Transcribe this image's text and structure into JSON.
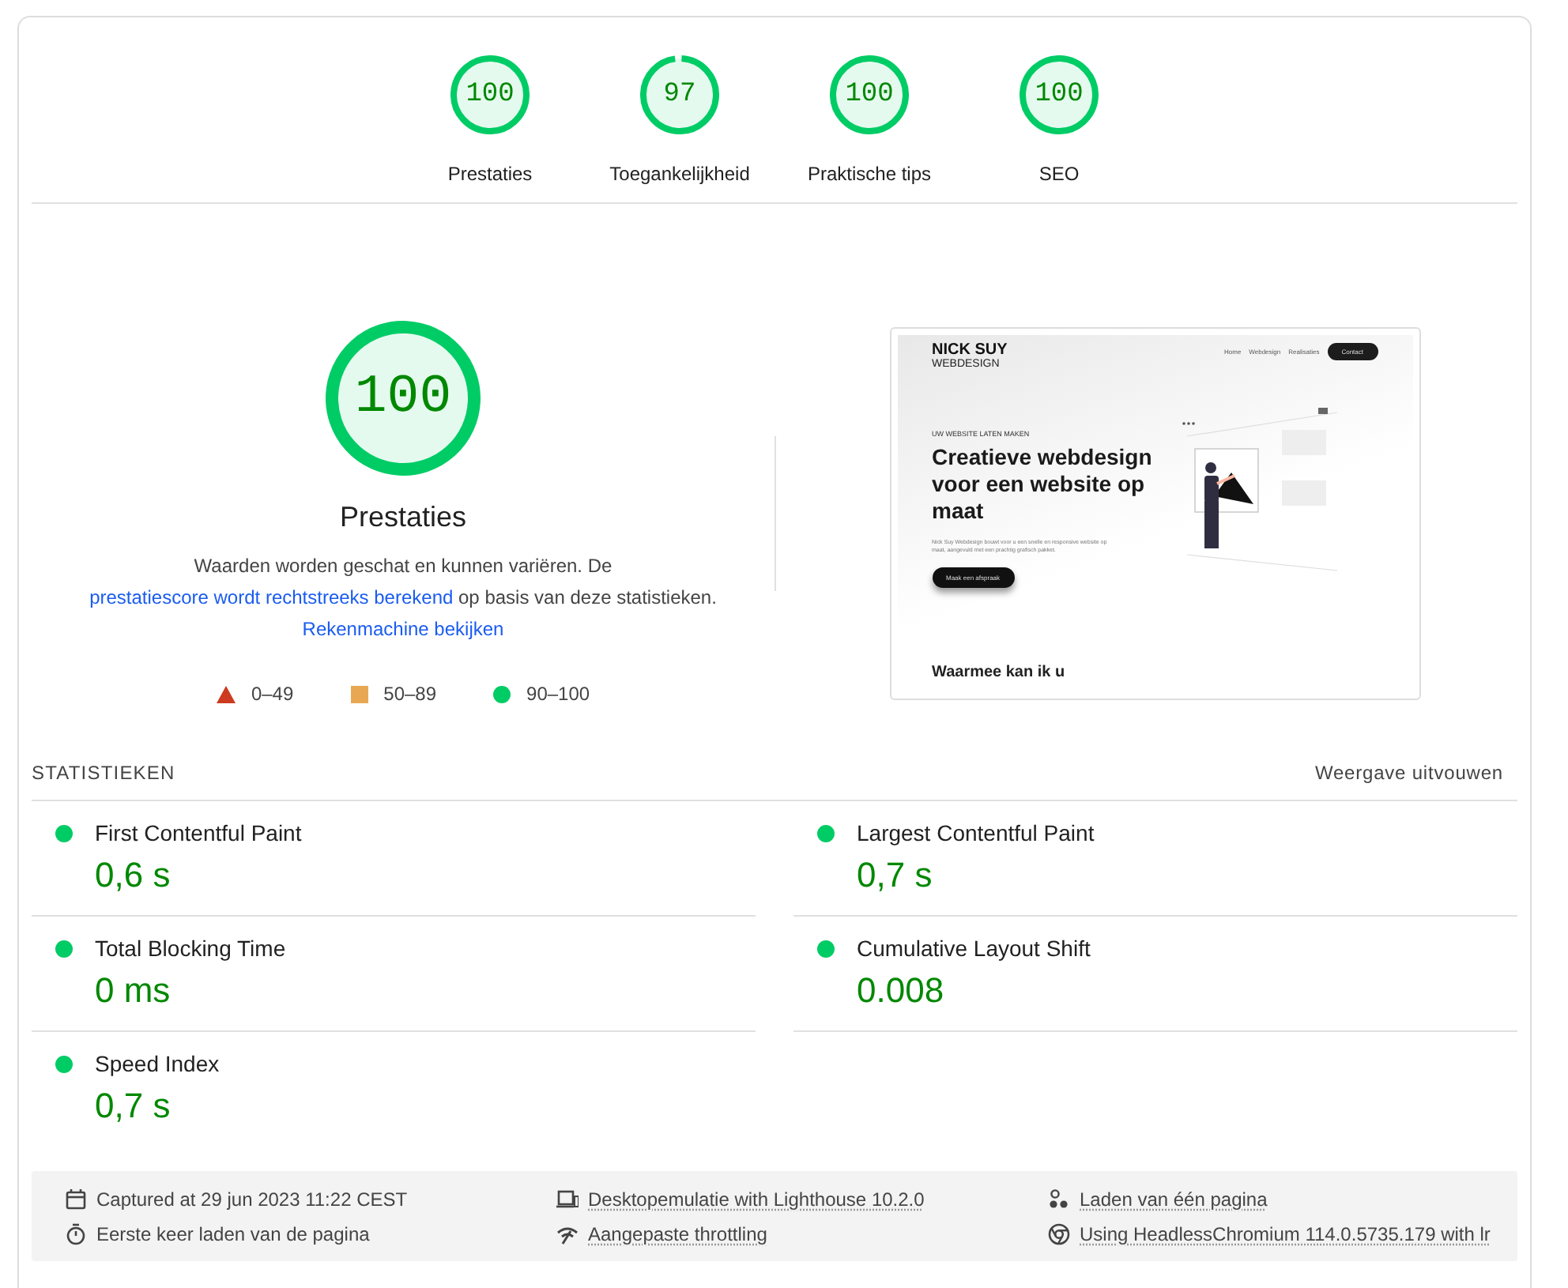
{
  "categories": [
    {
      "label": "Prestaties",
      "score": "100",
      "level": 1.0
    },
    {
      "label": "Toegankelijkheid",
      "score": "97",
      "level": 0.97
    },
    {
      "label": "Praktische tips",
      "score": "100",
      "level": 1.0
    },
    {
      "label": "SEO",
      "score": "100",
      "level": 1.0
    }
  ],
  "summary": {
    "score": "100",
    "level": 1.0,
    "title": "Prestaties",
    "description": [
      {
        "text": "Waarden worden geschat en kunnen variëren. De ",
        "link": false
      },
      {
        "text": "prestatiescore wordt rechtstreeks berekend",
        "link": true
      },
      {
        "text": " op basis van deze statistieken. ",
        "link": false
      },
      {
        "text": "Rekenmachine bekijken",
        "link": true
      }
    ],
    "legend": [
      {
        "kind": "fail",
        "label": "0–49"
      },
      {
        "kind": "average",
        "label": "50–89"
      },
      {
        "kind": "pass",
        "label": "90–100"
      }
    ]
  },
  "screenshot": {
    "logo": "NICK SUY",
    "logo_sub": "WEBDESIGN",
    "nav": [
      "Home",
      "Webdesign",
      "Realisaties"
    ],
    "nav_button": "Contact",
    "eyebrow": "UW WEBSITE LATEN MAKEN",
    "headline": "Creatieve webdesign voor een website op maat",
    "body": "Nick Suy Webdesign bouwt voor u een snelle en responsive website op maat, aangevuld met een prachtig grafisch pakket.",
    "cta": "Maak een afspraak",
    "next_heading": "Waarmee kan ik u"
  },
  "metrics_header": {
    "title": "STATISTIEKEN",
    "toggle": "Weergave uitvouwen"
  },
  "metrics": [
    {
      "name": "First Contentful Paint",
      "value": "0,6 s",
      "color": "#00cc66"
    },
    {
      "name": "Largest Contentful Paint",
      "value": "0,7 s",
      "color": "#00cc66"
    },
    {
      "name": "Total Blocking Time",
      "value": "0 ms",
      "color": "#00cc66"
    },
    {
      "name": "Cumulative Layout Shift",
      "value": "0.008",
      "color": "#00cc66"
    },
    {
      "name": "Speed Index",
      "value": "0,7 s",
      "color": "#00cc66"
    }
  ],
  "environment": [
    {
      "text": "Captured at 29 jun 2023 11:22 CEST",
      "link": false
    },
    {
      "text": "Desktopemulatie with Lighthouse 10.2.0",
      "link": true
    },
    {
      "text": "Laden van één pagina",
      "link": true
    },
    {
      "text": "Eerste keer laden van de pagina",
      "link": false
    },
    {
      "text": "Aangepaste throttling",
      "link": true
    },
    {
      "text": "Using HeadlessChromium 114.0.5735.179 with lr",
      "link": true
    }
  ]
}
